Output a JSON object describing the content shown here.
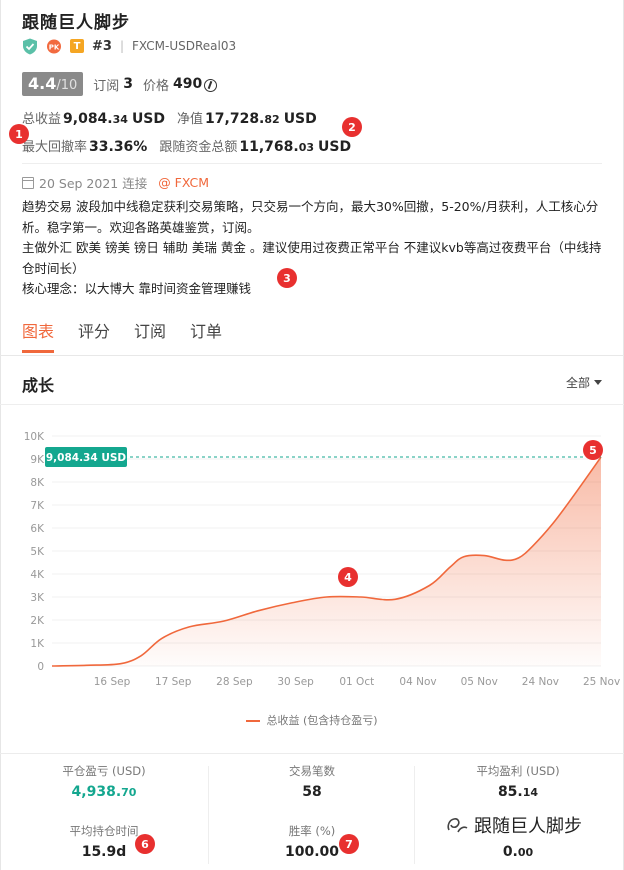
{
  "header": {
    "title": "跟随巨人脚步",
    "pk_label": "PK",
    "t_label": "T",
    "rank": "#3",
    "account": "FXCM-USDReal03"
  },
  "rating": {
    "score": "4.4",
    "max": "/10",
    "subs_label": "订阅",
    "subs_value": "3",
    "price_label": "价格",
    "price_value": "490"
  },
  "stats": {
    "profit_label": "总收益",
    "profit_int": "9,084.",
    "profit_dec": "34",
    "profit_unit": "USD",
    "equity_label": "净值",
    "equity_int": "17,728.",
    "equity_dec": "82",
    "equity_unit": "USD",
    "dd_label": "最大回撤率",
    "dd_value": "33.36%",
    "follow_label": "跟随资金总额",
    "follow_int": "11,768.",
    "follow_dec": "03",
    "follow_unit": "USD"
  },
  "connect": {
    "date": "20 Sep 2021 连接",
    "broker": "@ FXCM"
  },
  "description": [
    "趋势交易 波段加中线稳定获利交易策略，只交易一个方向，最大30%回撤，5-20%/月获利，人工核心分析。稳字第一。欢迎各路英雄鉴赏，订阅。",
    "主做外汇 欧美 镑美 镑日  辅助 美瑞 黄金 。建议使用过夜费正常平台 不建议kvb等高过夜费平台（中线持仓时间长）",
    "核心理念：以大博大 靠时间资金管理赚钱"
  ],
  "tabs": [
    "图表",
    "评分",
    "订阅",
    "订单"
  ],
  "section": {
    "title": "成长",
    "filter": "全部"
  },
  "markers": [
    "1",
    "2",
    "3",
    "4",
    "5",
    "6",
    "7"
  ],
  "chart_data": {
    "type": "area",
    "x_ticks": [
      "16 Sep",
      "17 Sep",
      "28 Sep",
      "30 Sep",
      "01 Oct",
      "04 Nov",
      "05 Nov",
      "24 Nov",
      "25 Nov"
    ],
    "y_ticks": [
      "0",
      "1K",
      "2K",
      "3K",
      "4K",
      "5K",
      "6K",
      "7K",
      "8K",
      "9K",
      "10K"
    ],
    "ylim": [
      0,
      10000
    ],
    "series": [
      {
        "name": "总收益 (包含持仓盈亏)",
        "x": [
          0,
          0.5,
          1,
          1.3,
          1.6,
          2.0,
          2.5,
          3.0,
          3.5,
          4.0,
          4.5,
          5.0,
          5.5,
          5.8,
          6.0,
          6.3,
          6.6,
          6.8,
          7.0,
          7.3,
          7.6,
          8.0
        ],
        "values": [
          0,
          30,
          100,
          450,
          1200,
          1700,
          1950,
          2400,
          2750,
          3000,
          3000,
          2900,
          3500,
          4300,
          4750,
          4800,
          4600,
          4700,
          5200,
          6200,
          7400,
          9084.34
        ]
      }
    ],
    "last_value_label": "9,084.34 USD",
    "grid": "horizontal"
  },
  "legend": "总收益 (包含持仓盈亏)",
  "summary": {
    "closed_pl_label": "平仓盈亏 (USD)",
    "closed_pl_int": "4,938.",
    "closed_pl_dec": "70",
    "trades_label": "交易笔数",
    "trades_value": "58",
    "avg_profit_label": "平均盈利 (USD)",
    "avg_profit_int": "85.",
    "avg_profit_dec": "14",
    "avg_hold_label": "平均持仓时间",
    "avg_hold_value": "15.9d",
    "win_label": "胜率 (%)",
    "win_value": "100.00",
    "third_int": "0.",
    "third_dec": "00"
  },
  "watermark": "跟随巨人脚步",
  "colors": {
    "accent": "#f0683c",
    "green": "#14a78f",
    "marker": "#e8302f"
  }
}
